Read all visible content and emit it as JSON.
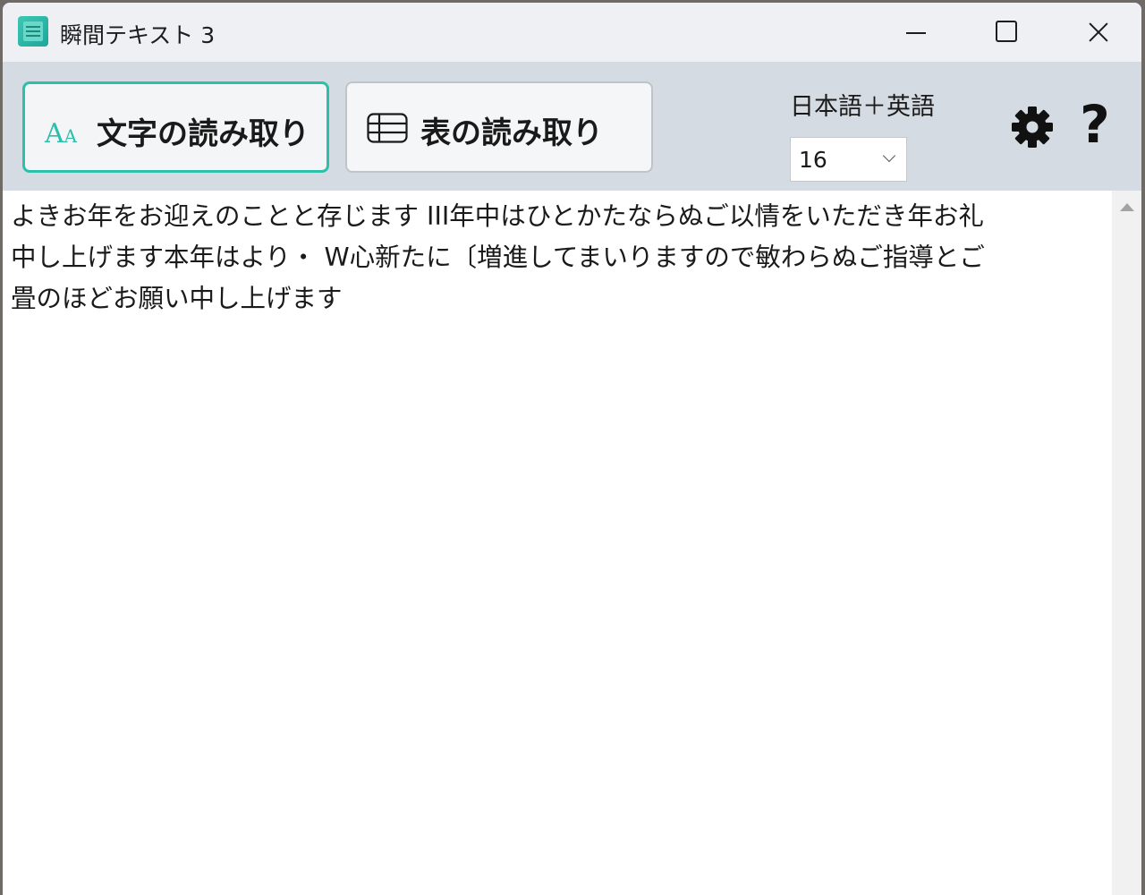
{
  "window": {
    "title": "瞬間テキスト 3"
  },
  "toolbar": {
    "text_read_label": "文字の読み取り",
    "table_read_label": "表の読み取り",
    "language_label": "日本語＋英語",
    "font_size_value": "16",
    "text_read_icon": "font-aa-icon",
    "table_read_icon": "table-icon",
    "settings_icon": "gear-icon",
    "help_symbol": "?"
  },
  "editor": {
    "lines": [
      "よきお年をお迎えのことと存じます III年中はひとかたならぬご以情をいただき年お礼",
      "中し上げます本年はより・ W心新たに〔増進してまいりますので敏わらぬご指導とご",
      "畳のほどお願い中し上げます"
    ]
  },
  "colors": {
    "accent": "#2cbfa9",
    "toolbar_bg": "#d5dbe2",
    "titlebar_bg": "#eef0f3"
  }
}
